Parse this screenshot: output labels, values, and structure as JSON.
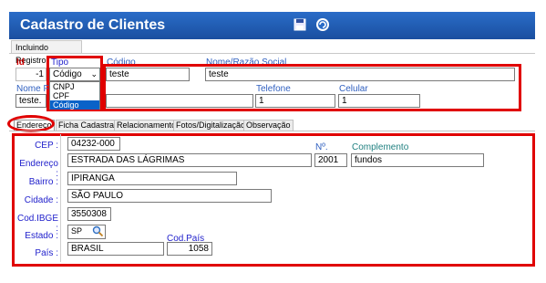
{
  "window": {
    "title": "Cadastro de Clientes",
    "save_icon": "floppy-icon",
    "refresh_icon": "refresh-icon"
  },
  "subtab": "Incluindo Registro",
  "header_fields": {
    "id_label": "Id",
    "id_value": "-1",
    "tipo_label": "Tipo",
    "tipo_value": "Código",
    "tipo_options": [
      "CNPJ",
      "CPF",
      "Código"
    ],
    "codigo_label": "Código",
    "codigo_value": "teste",
    "nome_label": "Nome/Razão Social",
    "nome_value": "teste",
    "nome_fantasia_label": "Nome F",
    "nome_fantasia_value": "teste.",
    "telefone_label": "Telefone",
    "telefone_value": "1",
    "celular_label": "Celular",
    "celular_value": "1"
  },
  "tabs": [
    "Endereço",
    "Ficha Cadastral",
    "Relacionamento",
    "Fotos/Digitalização",
    "Observação"
  ],
  "address": {
    "cep_label": "CEP :",
    "cep_value": "04232-000",
    "endereco_label": "Endereço :",
    "endereco_value": "ESTRADA DAS LÁGRIMAS",
    "numero_label": "Nº.",
    "numero_value": "2001",
    "complemento_label": "Complemento",
    "complemento_value": "fundos",
    "bairro_label": "Bairro :",
    "bairro_value": "IPIRANGA",
    "cidade_label": "Cidade :",
    "cidade_value": "SÃO PAULO",
    "ibge_label": "Cod.IBGE :",
    "ibge_value": "3550308",
    "estado_label": "Estado :",
    "estado_value": "SP",
    "cod_pais_label": "Cod.País",
    "pais_label": "País :",
    "pais_value": "BRASIL",
    "cod_pais_value": "1058"
  },
  "colors": {
    "titlebar": "#1a4fa0",
    "highlight": "#e00000",
    "label_blue": "#2222cc",
    "selected": "#0a62c8"
  }
}
